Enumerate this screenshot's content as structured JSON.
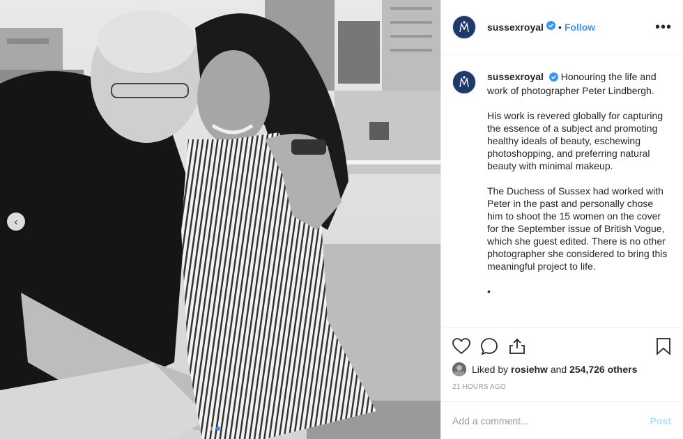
{
  "post": {
    "username": "sussexroyal",
    "follow_label": "Follow",
    "separator": "•",
    "more_label": "•••"
  },
  "caption": {
    "username": "sussexroyal",
    "paragraphs": [
      "Honouring the life and work of photographer Peter Lindbergh.",
      "His work is revered globally for capturing the essence of a subject and promoting healthy ideals of beauty, eschewing photoshopping, and preferring natural beauty with minimal makeup.",
      "The Duchess of Sussex had worked with Peter in the past and personally chose him to shoot the 15 women on the cover for the September issue of British Vogue, which she guest edited. There is no other photographer she considered to bring this meaningful project to life.",
      "•"
    ]
  },
  "likes": {
    "prefix": "Liked by",
    "user": "rosiehw",
    "joiner": "and",
    "count": "254,726 others"
  },
  "timestamp": "21 HOURS AGO",
  "comment": {
    "placeholder": "Add a comment...",
    "post_label": "Post"
  },
  "carousel": {
    "prev_icon": "chevron-left-icon",
    "current_slide": 2,
    "total_slides": 2
  },
  "colors": {
    "link": "#3897f0",
    "post_disabled": "#b2dffc",
    "muted": "#999999",
    "verified": "#3897f0"
  }
}
